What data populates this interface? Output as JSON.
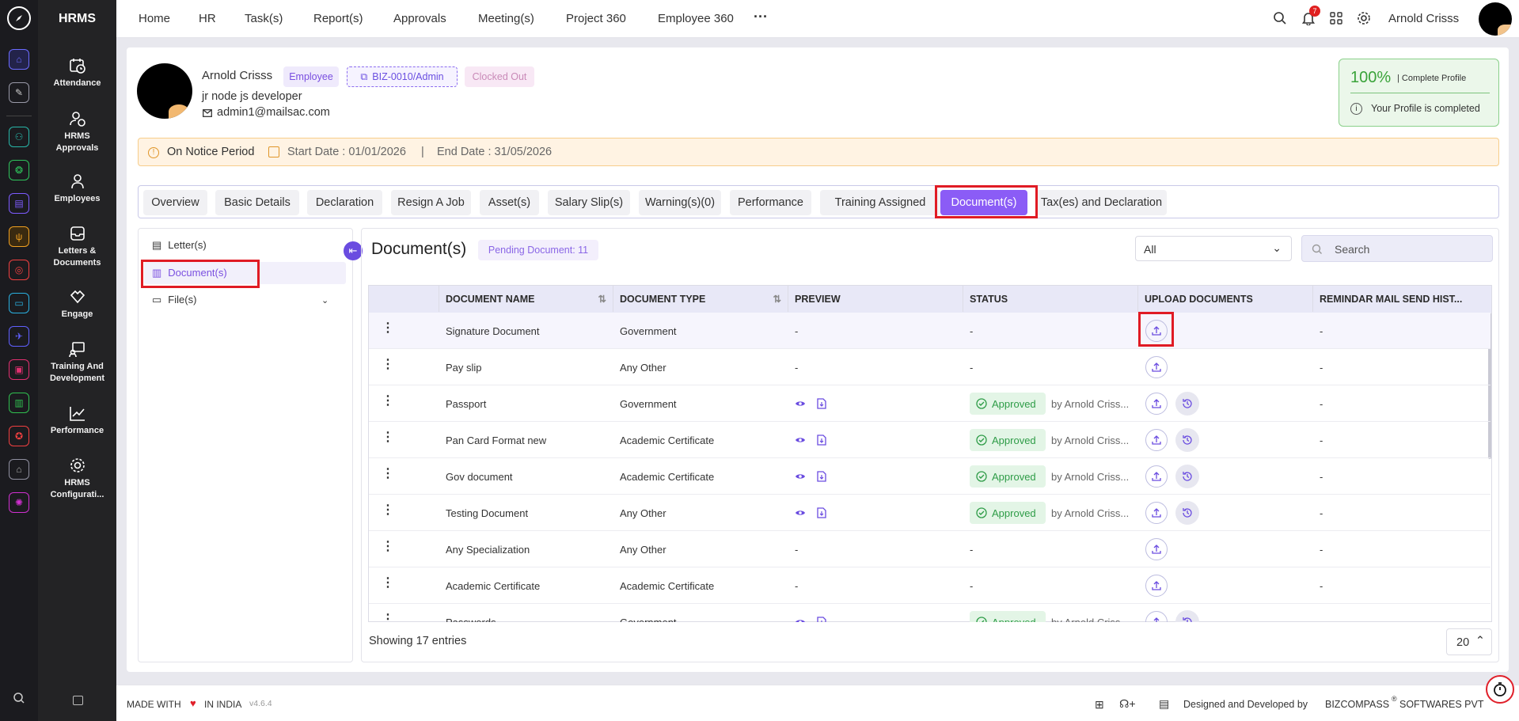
{
  "app": {
    "name": "HRMS",
    "user_name": "Arnold Crisss",
    "notification_count": "7"
  },
  "topnav": [
    "Home",
    "HR",
    "Task(s)",
    "Report(s)",
    "Approvals",
    "Meeting(s)",
    "Project 360",
    "Employee 360"
  ],
  "sidebar": [
    {
      "label": "Attendance",
      "icon": "calendar-clock-icon"
    },
    {
      "label": "HRMS Approvals",
      "icon": "user-check-icon"
    },
    {
      "label": "Employees",
      "icon": "user-icon"
    },
    {
      "label": "Letters & Documents",
      "icon": "inbox-icon"
    },
    {
      "label": "Engage",
      "icon": "handshake-icon"
    },
    {
      "label": "Training And Development",
      "icon": "presentation-icon"
    },
    {
      "label": "Performance",
      "icon": "trend-chart-icon"
    },
    {
      "label": "HRMS Configurati...",
      "icon": "gear-icon"
    }
  ],
  "profile": {
    "name": "Arnold Crisss",
    "role_badge": "Employee",
    "id_badge": "BIZ-0010/Admin",
    "status_badge": "Clocked Out",
    "title": "jr node js developer",
    "email": "admin1@mailsac.com",
    "completion": "100%",
    "completion_label": "| Complete Profile",
    "completion_msg": "Your Profile is completed"
  },
  "notice": {
    "label": "On Notice Period",
    "start": "Start Date : 01/01/2026",
    "sep": "|",
    "end": "End Date : 31/05/2026"
  },
  "tabs": [
    "Overview",
    "Basic Details",
    "Declaration",
    "Resign A Job",
    "Asset(s)",
    "Salary Slip(s)",
    "Warning(s)(0)",
    "Performance",
    "Training Assigned",
    "Document(s)",
    "Tax(es) and Declaration"
  ],
  "active_tab": "Document(s)",
  "left_menu": [
    "Letter(s)",
    "Document(s)",
    "File(s)"
  ],
  "documents": {
    "title": "Document(s)",
    "pending": "Pending Document: 11",
    "filter": "All",
    "search_placeholder": "Search",
    "columns": [
      "DOCUMENT NAME",
      "DOCUMENT TYPE",
      "PREVIEW",
      "STATUS",
      "UPLOAD DOCUMENTS",
      "REMINDAR MAIL SEND HIST..."
    ],
    "rows": [
      {
        "name": "Signature Document",
        "type": "Government",
        "preview": "-",
        "status": "-",
        "by": "",
        "reminder": "-"
      },
      {
        "name": "Pay slip",
        "type": "Any Other",
        "preview": "-",
        "status": "-",
        "by": "",
        "reminder": "-"
      },
      {
        "name": "Passport",
        "type": "Government",
        "preview": "",
        "status": "Approved",
        "by": "by Arnold Criss...",
        "reminder": "-"
      },
      {
        "name": "Pan Card Format new",
        "type": "Academic Certificate",
        "preview": "",
        "status": "Approved",
        "by": "by Arnold Criss...",
        "reminder": "-"
      },
      {
        "name": "Gov document",
        "type": "Academic Certificate",
        "preview": "",
        "status": "Approved",
        "by": "by Arnold Criss...",
        "reminder": "-"
      },
      {
        "name": "Testing Document",
        "type": "Any Other",
        "preview": "",
        "status": "Approved",
        "by": "by Arnold Criss...",
        "reminder": "-"
      },
      {
        "name": "Any Specialization",
        "type": "Any Other",
        "preview": "-",
        "status": "-",
        "by": "",
        "reminder": "-"
      },
      {
        "name": "Academic Certificate",
        "type": "Academic Certificate",
        "preview": "-",
        "status": "-",
        "by": "",
        "reminder": "-"
      },
      {
        "name": "Passwords",
        "type": "Government",
        "preview": "",
        "status": "Approved",
        "by": "by Arnold Criss...",
        "reminder": "-"
      }
    ],
    "footer": "Showing 17 entries",
    "page_size": "20"
  },
  "footer": {
    "made": "MADE WITH",
    "in_india": "IN INDIA",
    "version": "v4.6.4",
    "designed": "Designed and Developed by",
    "company": "BIZCOMPASS",
    "registered": "®",
    "company_suffix": "SOFTWARES PVT"
  },
  "colors": {
    "accent": "#8b5cf6",
    "approved": "#2e9c47",
    "highlight": "#e01b24",
    "notice_bg": "#fff4e4"
  }
}
